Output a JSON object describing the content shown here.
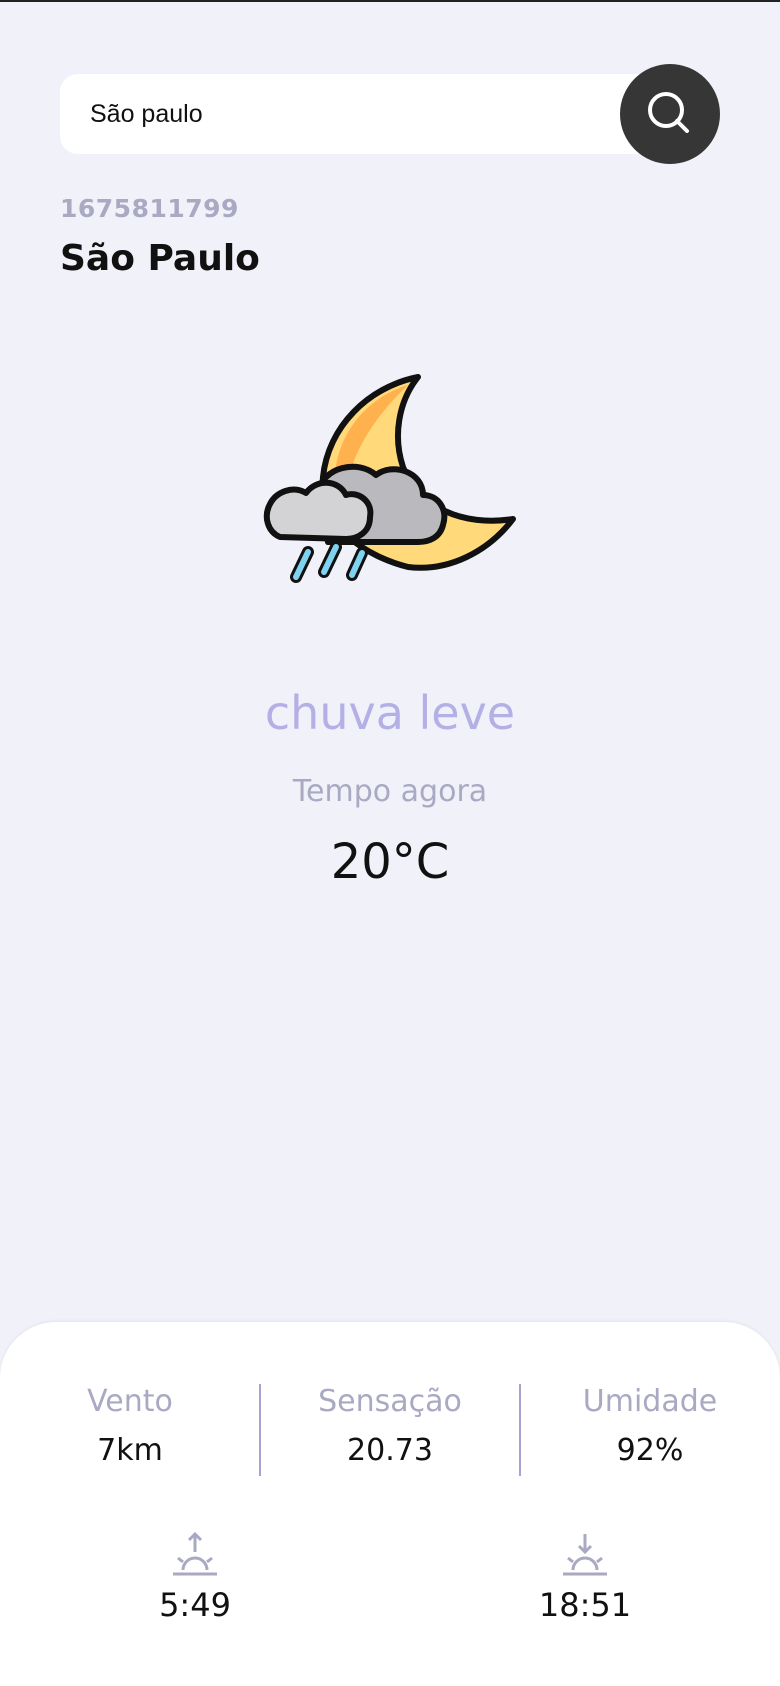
{
  "search": {
    "value": "São paulo",
    "button_icon": "search-icon"
  },
  "location": {
    "timestamp": "1675811799",
    "city": "São Paulo"
  },
  "current": {
    "icon": "moon-cloud-rain-icon",
    "condition": "chuva leve",
    "label": "Tempo agora",
    "temperature": "20°C"
  },
  "details": {
    "wind": {
      "label": "Vento",
      "value": "7km"
    },
    "feels_like": {
      "label": "Sensação",
      "value": "20.73"
    },
    "humidity": {
      "label": "Umidade",
      "value": "92%"
    }
  },
  "sun": {
    "sunrise": {
      "icon": "sunrise-icon",
      "time": "5:49"
    },
    "sunset": {
      "icon": "sunset-icon",
      "time": "18:51"
    }
  },
  "colors": {
    "background": "#f1f1f9",
    "accent": "#b4b0e6",
    "muted": "#a9a9c3",
    "search_button": "#363636"
  }
}
